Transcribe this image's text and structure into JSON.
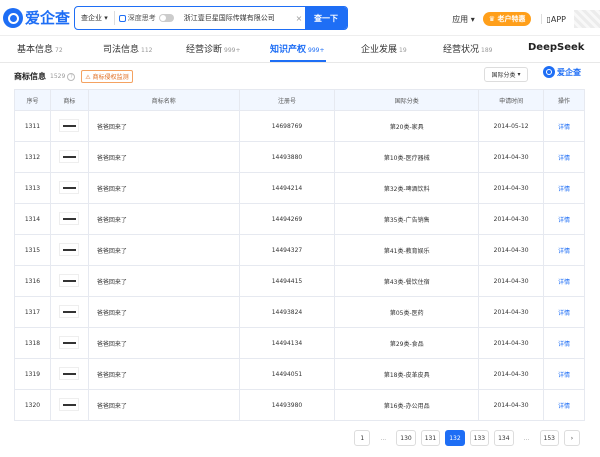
{
  "header": {
    "logo_text": "爱企查",
    "scope_label": "查企业",
    "deep_label": "深度思考",
    "search_value": "浙江壹巨星国际传媒有限公司",
    "clear_icon": "×",
    "search_button": "查一下",
    "app_menu": "应用",
    "vip_label": "老户特惠",
    "app_link": "APP"
  },
  "tabs": [
    {
      "label": "基本信息",
      "count": "72"
    },
    {
      "label": "司法信息",
      "count": "112"
    },
    {
      "label": "经营诊断",
      "count": "999+"
    },
    {
      "label": "知识产权",
      "count": "999+"
    },
    {
      "label": "企业发展",
      "count": "19"
    },
    {
      "label": "经营状况",
      "count": "189"
    }
  ],
  "deepseek_tab": "DeepSeek",
  "section": {
    "title": "商标信息",
    "count": "1529",
    "warn_badge": "商标侵权监测",
    "filter_label": "国际分类",
    "badge_logo": "爱企查"
  },
  "table": {
    "columns": [
      "序号",
      "商标",
      "商标名称",
      "注册号",
      "国际分类",
      "申请时间",
      "操作"
    ],
    "rows": [
      {
        "no": "1311",
        "name": "爸爸回来了",
        "reg": "14698769",
        "cls": "第20类-家具",
        "date": "2014-05-12",
        "action": "详情"
      },
      {
        "no": "1312",
        "name": "爸爸回来了",
        "reg": "14493880",
        "cls": "第10类-医疗器械",
        "date": "2014-04-30",
        "action": "详情"
      },
      {
        "no": "1313",
        "name": "爸爸回来了",
        "reg": "14494214",
        "cls": "第32类-啤酒饮料",
        "date": "2014-04-30",
        "action": "详情"
      },
      {
        "no": "1314",
        "name": "爸爸回来了",
        "reg": "14494269",
        "cls": "第35类-广告销售",
        "date": "2014-04-30",
        "action": "详情"
      },
      {
        "no": "1315",
        "name": "爸爸回来了",
        "reg": "14494327",
        "cls": "第41类-教育娱乐",
        "date": "2014-04-30",
        "action": "详情"
      },
      {
        "no": "1316",
        "name": "爸爸回来了",
        "reg": "14494415",
        "cls": "第43类-餐饮住宿",
        "date": "2014-04-30",
        "action": "详情"
      },
      {
        "no": "1317",
        "name": "爸爸回来了",
        "reg": "14493824",
        "cls": "第05类-医药",
        "date": "2014-04-30",
        "action": "详情"
      },
      {
        "no": "1318",
        "name": "爸爸回来了",
        "reg": "14494134",
        "cls": "第29类-食品",
        "date": "2014-04-30",
        "action": "详情"
      },
      {
        "no": "1319",
        "name": "爸爸回来了",
        "reg": "14494051",
        "cls": "第18类-皮革皮具",
        "date": "2014-04-30",
        "action": "详情"
      },
      {
        "no": "1320",
        "name": "爸爸回来了",
        "reg": "14493980",
        "cls": "第16类-办公用品",
        "date": "2014-04-30",
        "action": "详情"
      }
    ]
  },
  "pagination": {
    "pages": [
      "1",
      "...",
      "130",
      "131",
      "132",
      "133",
      "134",
      "...",
      "153"
    ],
    "active": "132",
    "next_icon": "›"
  }
}
